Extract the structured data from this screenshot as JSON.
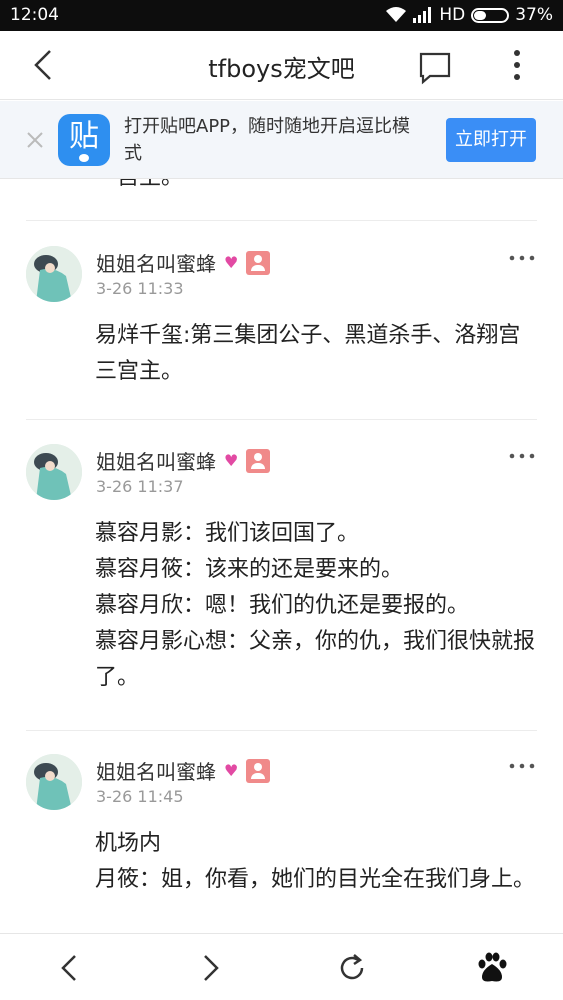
{
  "status_bar": {
    "time": "12:04",
    "network": "HD",
    "battery": "37%",
    "battery_level": 0.37
  },
  "header": {
    "title": "tfboys宠文吧"
  },
  "banner": {
    "logo_text": "贴",
    "text": "打开贴吧APP，随时随地开启逗比模式",
    "open_label": "立即打开"
  },
  "clipped_text": "一宫主。",
  "posts": [
    {
      "username": "姐姐名叫蜜蜂",
      "time": "3-26 11:33",
      "lines": [
        "易烊千玺:第三集团公子、黑道杀手、洛翔宫三宫主。"
      ]
    },
    {
      "username": "姐姐名叫蜜蜂",
      "time": "3-26 11:37",
      "lines": [
        "慕容月影：我们该回国了。",
        "慕容月筱：该来的还是要来的。",
        "慕容月欣：嗯！我们的仇还是要报的。",
        "慕容月影心想：父亲，你的仇，我们很快就报了。"
      ]
    },
    {
      "username": "姐姐名叫蜜蜂",
      "time": "3-26 11:45",
      "lines": [
        "机场内",
        "月筱：姐，你看，她们的目光全在我们身上。"
      ]
    }
  ],
  "colors": {
    "accent": "#3a8ef6",
    "logo": "#2e8ff0",
    "badge": "#f08a8a"
  }
}
